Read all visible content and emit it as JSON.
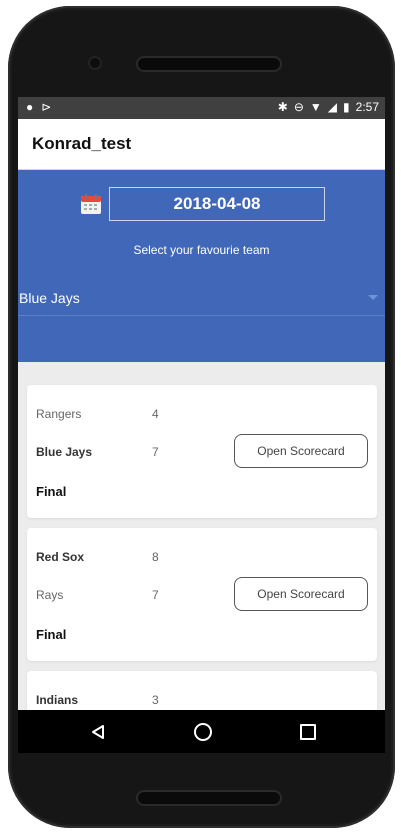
{
  "statusbar": {
    "time": "2:57"
  },
  "app": {
    "title": "Konrad_test"
  },
  "hero": {
    "date": "2018-04-08",
    "hint": "Select your favourie team",
    "selected_team": "Blue Jays"
  },
  "games": [
    {
      "team1": "Rangers",
      "score1": "4",
      "team2": "Blue Jays",
      "score2": "7",
      "status": "Final",
      "button": "Open Scorecard",
      "bold_team": 2
    },
    {
      "team1": "Red Sox",
      "score1": "8",
      "team2": "Rays",
      "score2": "7",
      "status": "Final",
      "button": "Open Scorecard",
      "bold_team": 1
    },
    {
      "team1": "Indians",
      "score1": "3"
    }
  ],
  "colors": {
    "hero": "#4067b8",
    "statusbar": "#404040"
  }
}
